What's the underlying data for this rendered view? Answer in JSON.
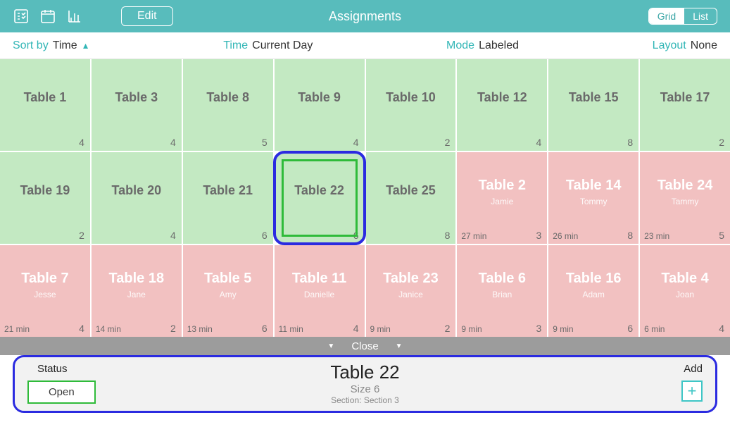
{
  "header": {
    "title": "Assignments",
    "edit_label": "Edit",
    "view_toggle": {
      "grid": "Grid",
      "list": "List",
      "active": "grid"
    }
  },
  "filter": {
    "sort_label": "Sort by",
    "sort_value": "Time",
    "time_label": "Time",
    "time_value": "Current Day",
    "mode_label": "Mode",
    "mode_value": "Labeled",
    "layout_label": "Layout",
    "layout_value": "None"
  },
  "tables": [
    {
      "name": "Table 1",
      "status": "open",
      "size": 4
    },
    {
      "name": "Table 3",
      "status": "open",
      "size": 4
    },
    {
      "name": "Table 8",
      "status": "open",
      "size": 5
    },
    {
      "name": "Table 9",
      "status": "open",
      "size": 4
    },
    {
      "name": "Table 10",
      "status": "open",
      "size": 2
    },
    {
      "name": "Table 12",
      "status": "open",
      "size": 4
    },
    {
      "name": "Table 15",
      "status": "open",
      "size": 8
    },
    {
      "name": "Table 17",
      "status": "open",
      "size": 2
    },
    {
      "name": "Table 19",
      "status": "open",
      "size": 2
    },
    {
      "name": "Table 20",
      "status": "open",
      "size": 4
    },
    {
      "name": "Table 21",
      "status": "open",
      "size": 6
    },
    {
      "name": "Table 22",
      "status": "open",
      "size": 6,
      "selected": true
    },
    {
      "name": "Table 25",
      "status": "open",
      "size": 8
    },
    {
      "name": "Table 2",
      "status": "occupied",
      "server": "Jamie",
      "elapsed": "27 min",
      "size": 3
    },
    {
      "name": "Table 14",
      "status": "occupied",
      "server": "Tommy",
      "elapsed": "26 min",
      "size": 8
    },
    {
      "name": "Table 24",
      "status": "occupied",
      "server": "Tammy",
      "elapsed": "23 min",
      "size": 5
    },
    {
      "name": "Table 7",
      "status": "occupied",
      "server": "Jesse",
      "elapsed": "21 min",
      "size": 4
    },
    {
      "name": "Table 18",
      "status": "occupied",
      "server": "Jane",
      "elapsed": "14 min",
      "size": 2
    },
    {
      "name": "Table 5",
      "status": "occupied",
      "server": "Amy",
      "elapsed": "13 min",
      "size": 6
    },
    {
      "name": "Table 11",
      "status": "occupied",
      "server": "Danielle",
      "elapsed": "11 min",
      "size": 4
    },
    {
      "name": "Table 23",
      "status": "occupied",
      "server": "Janice",
      "elapsed": "9 min",
      "size": 2
    },
    {
      "name": "Table 6",
      "status": "occupied",
      "server": "Brian",
      "elapsed": "9 min",
      "size": 3
    },
    {
      "name": "Table 16",
      "status": "occupied",
      "server": "Adam",
      "elapsed": "9 min",
      "size": 6
    },
    {
      "name": "Table 4",
      "status": "occupied",
      "server": "Joan",
      "elapsed": "6 min",
      "size": 4
    }
  ],
  "closebar": {
    "label": "Close"
  },
  "detail": {
    "status_label": "Status",
    "status_value": "Open",
    "table_name": "Table 22",
    "size_label": "Size 6",
    "section_label": "Section: Section 3",
    "add_label": "Add"
  },
  "colors": {
    "teal": "#58bcbc",
    "open_cell": "#c3e9c2",
    "occupied_cell": "#f2c1c1",
    "select_blue": "#2b2be0",
    "select_green": "#2fbb3a"
  }
}
